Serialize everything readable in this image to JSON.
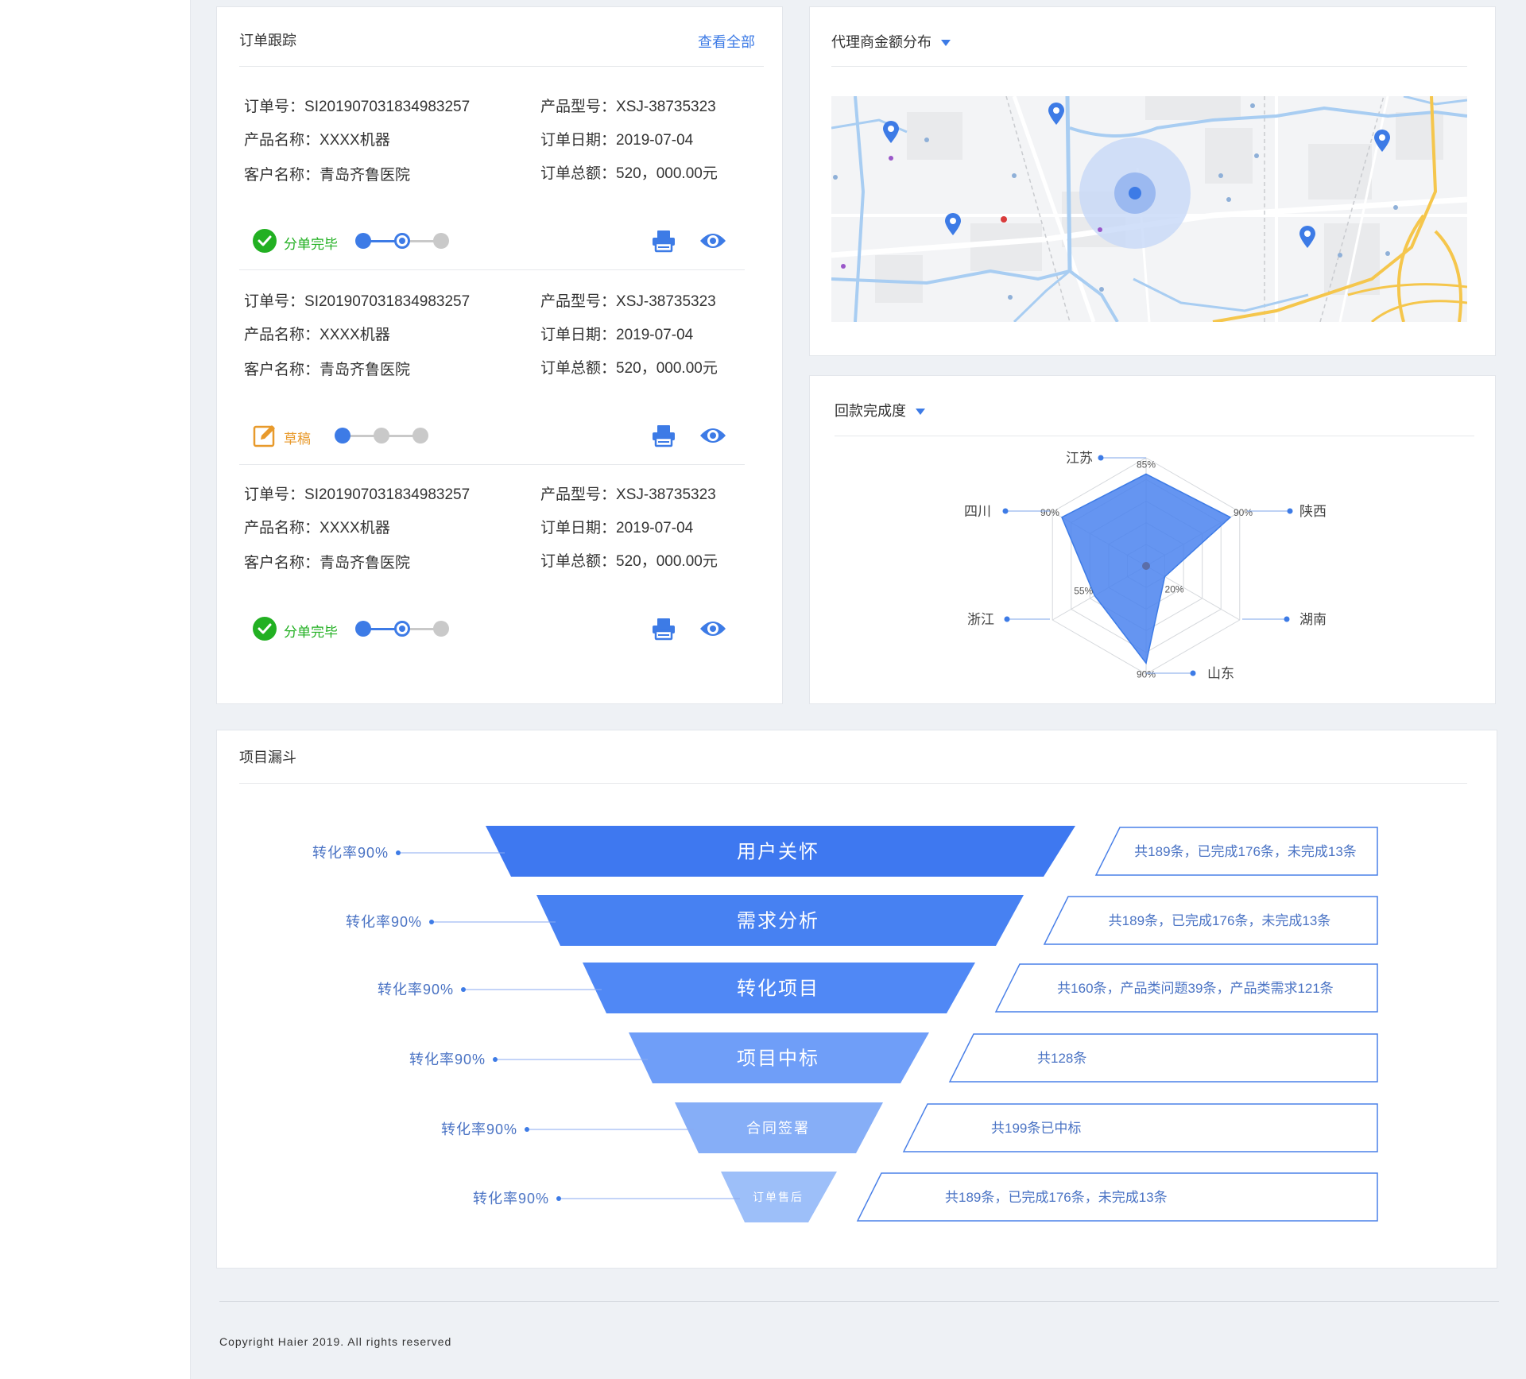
{
  "order_tracking": {
    "title": "订单跟踪",
    "view_all": "查看全部",
    "orders": [
      {
        "order_no_label": "订单号：",
        "order_no": "SI201907031834983257",
        "model_label": "产品型号：",
        "model": "XSJ-38735323",
        "product_label": "产品名称：",
        "product": "XXXX机器",
        "date_label": "订单日期：",
        "date": "2019-07-04",
        "customer_label": "客户名称：",
        "customer": "青岛齐鲁医院",
        "total_label": "订单总额：",
        "total": "520，000.00元",
        "status": "分单完毕",
        "status_type": "done",
        "progress_step": 2,
        "progress_total": 3
      },
      {
        "order_no_label": "订单号：",
        "order_no": "SI201907031834983257",
        "model_label": "产品型号：",
        "model": "XSJ-38735323",
        "product_label": "产品名称：",
        "product": "XXXX机器",
        "date_label": "订单日期：",
        "date": "2019-07-04",
        "customer_label": "客户名称：",
        "customer": "青岛齐鲁医院",
        "total_label": "订单总额：",
        "total": "520，000.00元",
        "status": "草稿",
        "status_type": "draft",
        "progress_step": 1,
        "progress_total": 3
      },
      {
        "order_no_label": "订单号：",
        "order_no": "SI201907031834983257",
        "model_label": "产品型号：",
        "model": "XSJ-38735323",
        "product_label": "产品名称：",
        "product": "XXXX机器",
        "date_label": "订单日期：",
        "date": "2019-07-04",
        "customer_label": "客户名称：",
        "customer": "青岛齐鲁医院",
        "total_label": "订单总额：",
        "total": "520，000.00元",
        "status": "分单完毕",
        "status_type": "done",
        "progress_step": 2,
        "progress_total": 3
      }
    ],
    "icons": [
      "printer-icon",
      "eye-icon"
    ]
  },
  "agent_distribution": {
    "title": "代理商金额分布",
    "icon": "map-pin-icon"
  },
  "payment_completion": {
    "title": "回款完成度"
  },
  "project_funnel": {
    "title": "项目漏斗"
  },
  "footer": {
    "copyright": "Copyright Haier 2019. All rights reserved"
  },
  "colors": {
    "accent": "#3d7be6",
    "success": "#22b022",
    "warning": "#e89a2c",
    "funnel": [
      "#3e78f0",
      "#4781f2",
      "#5088f5",
      "#6f9ef8",
      "#86aef7",
      "#9dbff9"
    ]
  },
  "chart_data": [
    {
      "type": "radar",
      "title": "回款完成度",
      "axes": [
        "江苏",
        "陕西",
        "湖南",
        "山东",
        "浙江",
        "四川"
      ],
      "series": [
        {
          "values": [
            85,
            90,
            20,
            90,
            55,
            90
          ]
        }
      ],
      "value_labels": [
        "85%",
        "90%",
        "20%",
        "90%",
        "55%",
        "90%"
      ],
      "max": 100,
      "rings": 5
    },
    {
      "type": "funnel",
      "title": "项目漏斗",
      "stages": [
        "用户关怀",
        "需求分析",
        "转化项目",
        "项目中标",
        "合同签署",
        "订单售后"
      ],
      "conversion_labels": [
        "转化率90%",
        "转化率90%",
        "转化率90%",
        "转化率90%",
        "转化率90%",
        "转化率90%"
      ],
      "descriptions": [
        "共189条，已完成176条，未完成13条",
        "共189条，已完成176条，未完成13条",
        "共160条，产品类问题39条，产品类需求121条",
        "共128条",
        "共199条已中标",
        "共189条，已完成176条，未完成13条"
      ]
    }
  ]
}
